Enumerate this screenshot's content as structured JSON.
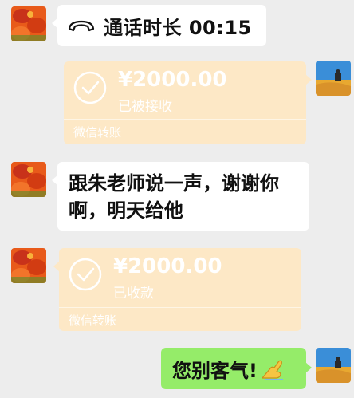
{
  "messages": {
    "call": {
      "text": "通话时长 00:15"
    },
    "transfer_1": {
      "amount": "¥2000.00",
      "status": "已被接收",
      "footer": "微信转账"
    },
    "text_1": {
      "text": "跟朱老师说一声，谢谢你啊，明天给他"
    },
    "transfer_2": {
      "amount": "¥2000.00",
      "status": "已收款",
      "footer": "微信转账"
    },
    "reply": {
      "text": "您别客气!",
      "emoji": "ok-hand-emoji"
    }
  },
  "icons": {
    "call": "phone-handset-icon",
    "check": "check-circle-icon",
    "contact_avatar": "crawfish-avatar",
    "self_avatar": "desert-avatar"
  },
  "colors": {
    "background": "#ededed",
    "bubble_white": "#ffffff",
    "bubble_green": "#95ec69",
    "transfer_faded": "#fde8c6"
  }
}
